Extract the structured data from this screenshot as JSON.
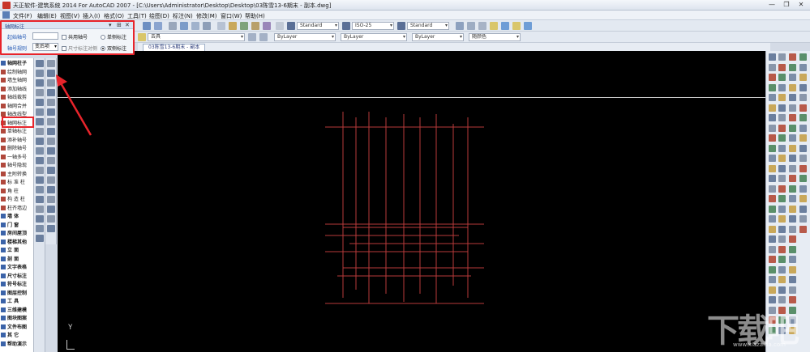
{
  "window": {
    "title": "天正软件-建筑系统 2014  For AutoCAD 2007 - [C:\\Users\\Administrator\\Desktop\\Desktop\\03陈雪13-6期末 - 副本.dwg]",
    "minimize": "—",
    "restore": "❐",
    "close": "✕"
  },
  "menu": {
    "items": [
      "文件(F)",
      "编辑(E)",
      "视图(V)",
      "插入(I)",
      "格式(O)",
      "工具(T)",
      "绘图(D)",
      "标注(N)",
      "修改(M)",
      "窗口(W)",
      "帮助(H)"
    ]
  },
  "toolbar": {
    "text_style": "Standard",
    "dim_style": "ISO-25",
    "table_style": "Standard",
    "layer": "去具",
    "color": "ByLayer",
    "linetype": "ByLayer",
    "lineweight": "ByLayer",
    "plot_style": "随颜色"
  },
  "document_tab": "03陈雪13-6期末 - 副本",
  "dialog": {
    "title": "轴网标注",
    "pin": "▾",
    "autohide": "⊞",
    "close": "✕",
    "start_label": "起始轴号",
    "start_value": "",
    "shared_label": "共用轴号",
    "single_label": "单侧标注",
    "rule_label": "轴号规则",
    "rule_value": "变后项",
    "dim_align_label": "尺寸标注对侧",
    "double_label": "双侧标注",
    "selected_side": "双侧标注"
  },
  "left_panel": {
    "items": [
      {
        "label": "轴网柱子",
        "cat": true
      },
      {
        "label": "绘制轴网",
        "cat": false
      },
      {
        "label": "墙生轴网",
        "cat": false
      },
      {
        "label": "添加轴线",
        "cat": false
      },
      {
        "label": "轴线裁剪",
        "cat": false
      },
      {
        "label": "轴网合并",
        "cat": false
      },
      {
        "label": "轴改线型",
        "cat": false
      },
      {
        "label": "轴网标注",
        "cat": false
      },
      {
        "label": "单轴标注",
        "cat": false
      },
      {
        "label": "添补轴号",
        "cat": false
      },
      {
        "label": "删除轴号",
        "cat": false
      },
      {
        "label": "一轴多号",
        "cat": false
      },
      {
        "label": "轴号隐现",
        "cat": false
      },
      {
        "label": "主附转换",
        "cat": false
      },
      {
        "label": "标 准 柱",
        "cat": false
      },
      {
        "label": "角    柱",
        "cat": false
      },
      {
        "label": "构 造 柱",
        "cat": false
      },
      {
        "label": "柱齐墙边",
        "cat": false
      },
      {
        "label": "墙    体",
        "cat": true
      },
      {
        "label": "门    窗",
        "cat": true
      },
      {
        "label": "房间屋顶",
        "cat": true
      },
      {
        "label": "楼梯其他",
        "cat": true
      },
      {
        "label": "立    面",
        "cat": true
      },
      {
        "label": "剖    面",
        "cat": true
      },
      {
        "label": "文字表格",
        "cat": true
      },
      {
        "label": "尺寸标注",
        "cat": true
      },
      {
        "label": "符号标注",
        "cat": true
      },
      {
        "label": "图层控制",
        "cat": true
      },
      {
        "label": "工    具",
        "cat": true
      },
      {
        "label": "三维建模",
        "cat": true
      },
      {
        "label": "图块图案",
        "cat": true
      },
      {
        "label": "文件布图",
        "cat": true
      },
      {
        "label": "其    它",
        "cat": true
      },
      {
        "label": "帮助演示",
        "cat": true
      }
    ]
  },
  "canvas": {
    "ucs_label": "Y"
  },
  "watermark": {
    "text": "下载吧",
    "sub": "www.xiazaiba.com"
  },
  "colors": {
    "accent": "#e8242b",
    "grid_line": "#b83a3a",
    "canvas_bg": "#000000"
  }
}
